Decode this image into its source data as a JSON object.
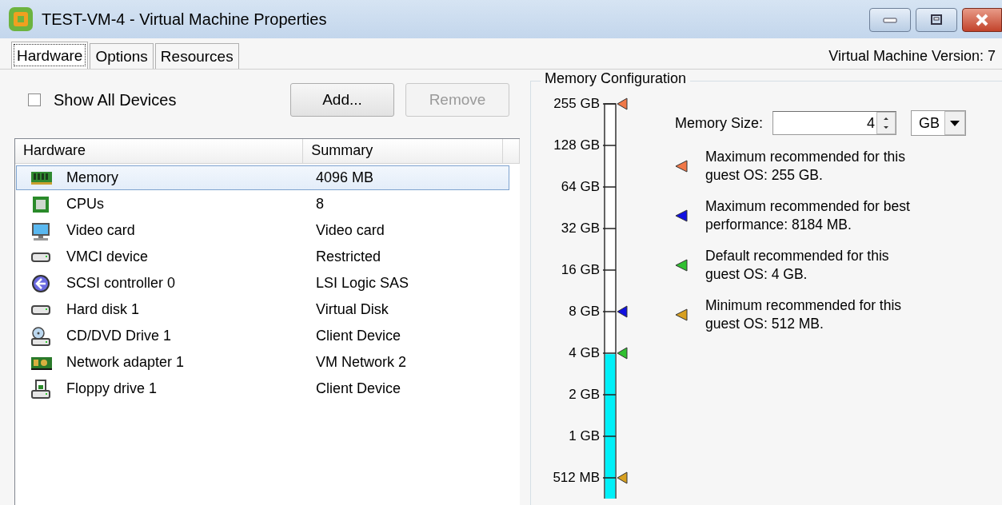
{
  "window": {
    "title": "TEST-VM-4 - Virtual Machine Properties"
  },
  "tabs": [
    {
      "label": "Hardware",
      "selected": true
    },
    {
      "label": "Options",
      "selected": false
    },
    {
      "label": "Resources",
      "selected": false
    }
  ],
  "version": "Virtual Machine Version: 7",
  "show_all_devices": {
    "label": "Show All Devices",
    "checked": false
  },
  "buttons": [
    {
      "label": "Add...",
      "disabled": false
    },
    {
      "label": "Remove",
      "disabled": true
    }
  ],
  "table": {
    "columns": [
      "Hardware",
      "Summary"
    ],
    "rows": [
      {
        "kind": "memory",
        "name": "Memory",
        "summary": "4096 MB",
        "selected": true
      },
      {
        "kind": "cpu",
        "name": "CPUs",
        "summary": "8",
        "selected": false
      },
      {
        "kind": "monitor",
        "name": "Video card",
        "summary": "Video card",
        "selected": false
      },
      {
        "kind": "drive",
        "name": "VMCI device",
        "summary": "Restricted",
        "selected": false
      },
      {
        "kind": "controller",
        "name": "SCSI controller 0",
        "summary": "LSI Logic SAS",
        "selected": false
      },
      {
        "kind": "drive",
        "name": "Hard disk 1",
        "summary": "Virtual Disk",
        "selected": false
      },
      {
        "kind": "cdrom",
        "name": "CD/DVD Drive 1",
        "summary": "Client Device",
        "selected": false
      },
      {
        "kind": "network",
        "name": "Network adapter 1",
        "summary": "VM Network 2",
        "selected": false
      },
      {
        "kind": "floppy",
        "name": "Floppy drive 1",
        "summary": "Client Device",
        "selected": false
      }
    ]
  },
  "memory_configuration": {
    "title": "Memory Configuration",
    "level": 0.366,
    "scale": [
      {
        "label": "255 GB",
        "color": "#f07848"
      },
      {
        "label": "128 GB"
      },
      {
        "label": "64 GB"
      },
      {
        "label": "32 GB"
      },
      {
        "label": "16 GB"
      },
      {
        "label": "8 GB",
        "color": "#1010e0"
      },
      {
        "label": "4 GB",
        "color": "#30c030"
      },
      {
        "label": "2 GB"
      },
      {
        "label": "1 GB"
      },
      {
        "label": "512 MB",
        "color": "#d8a020"
      }
    ],
    "size": {
      "label": "Memory Size:",
      "value": "4",
      "unit": "GB"
    },
    "legend": [
      {
        "color": "#f07848",
        "text": "Maximum recommended for this\nguest OS: 255 GB."
      },
      {
        "color": "#1010e0",
        "text": "Maximum recommended for best\nperformance: 8184 MB."
      },
      {
        "color": "#30c030",
        "text": "Default recommended for this\nguest OS: 4 GB."
      },
      {
        "color": "#d8a020",
        "text": "Minimum recommended for this\nguest OS: 512 MB."
      }
    ]
  }
}
